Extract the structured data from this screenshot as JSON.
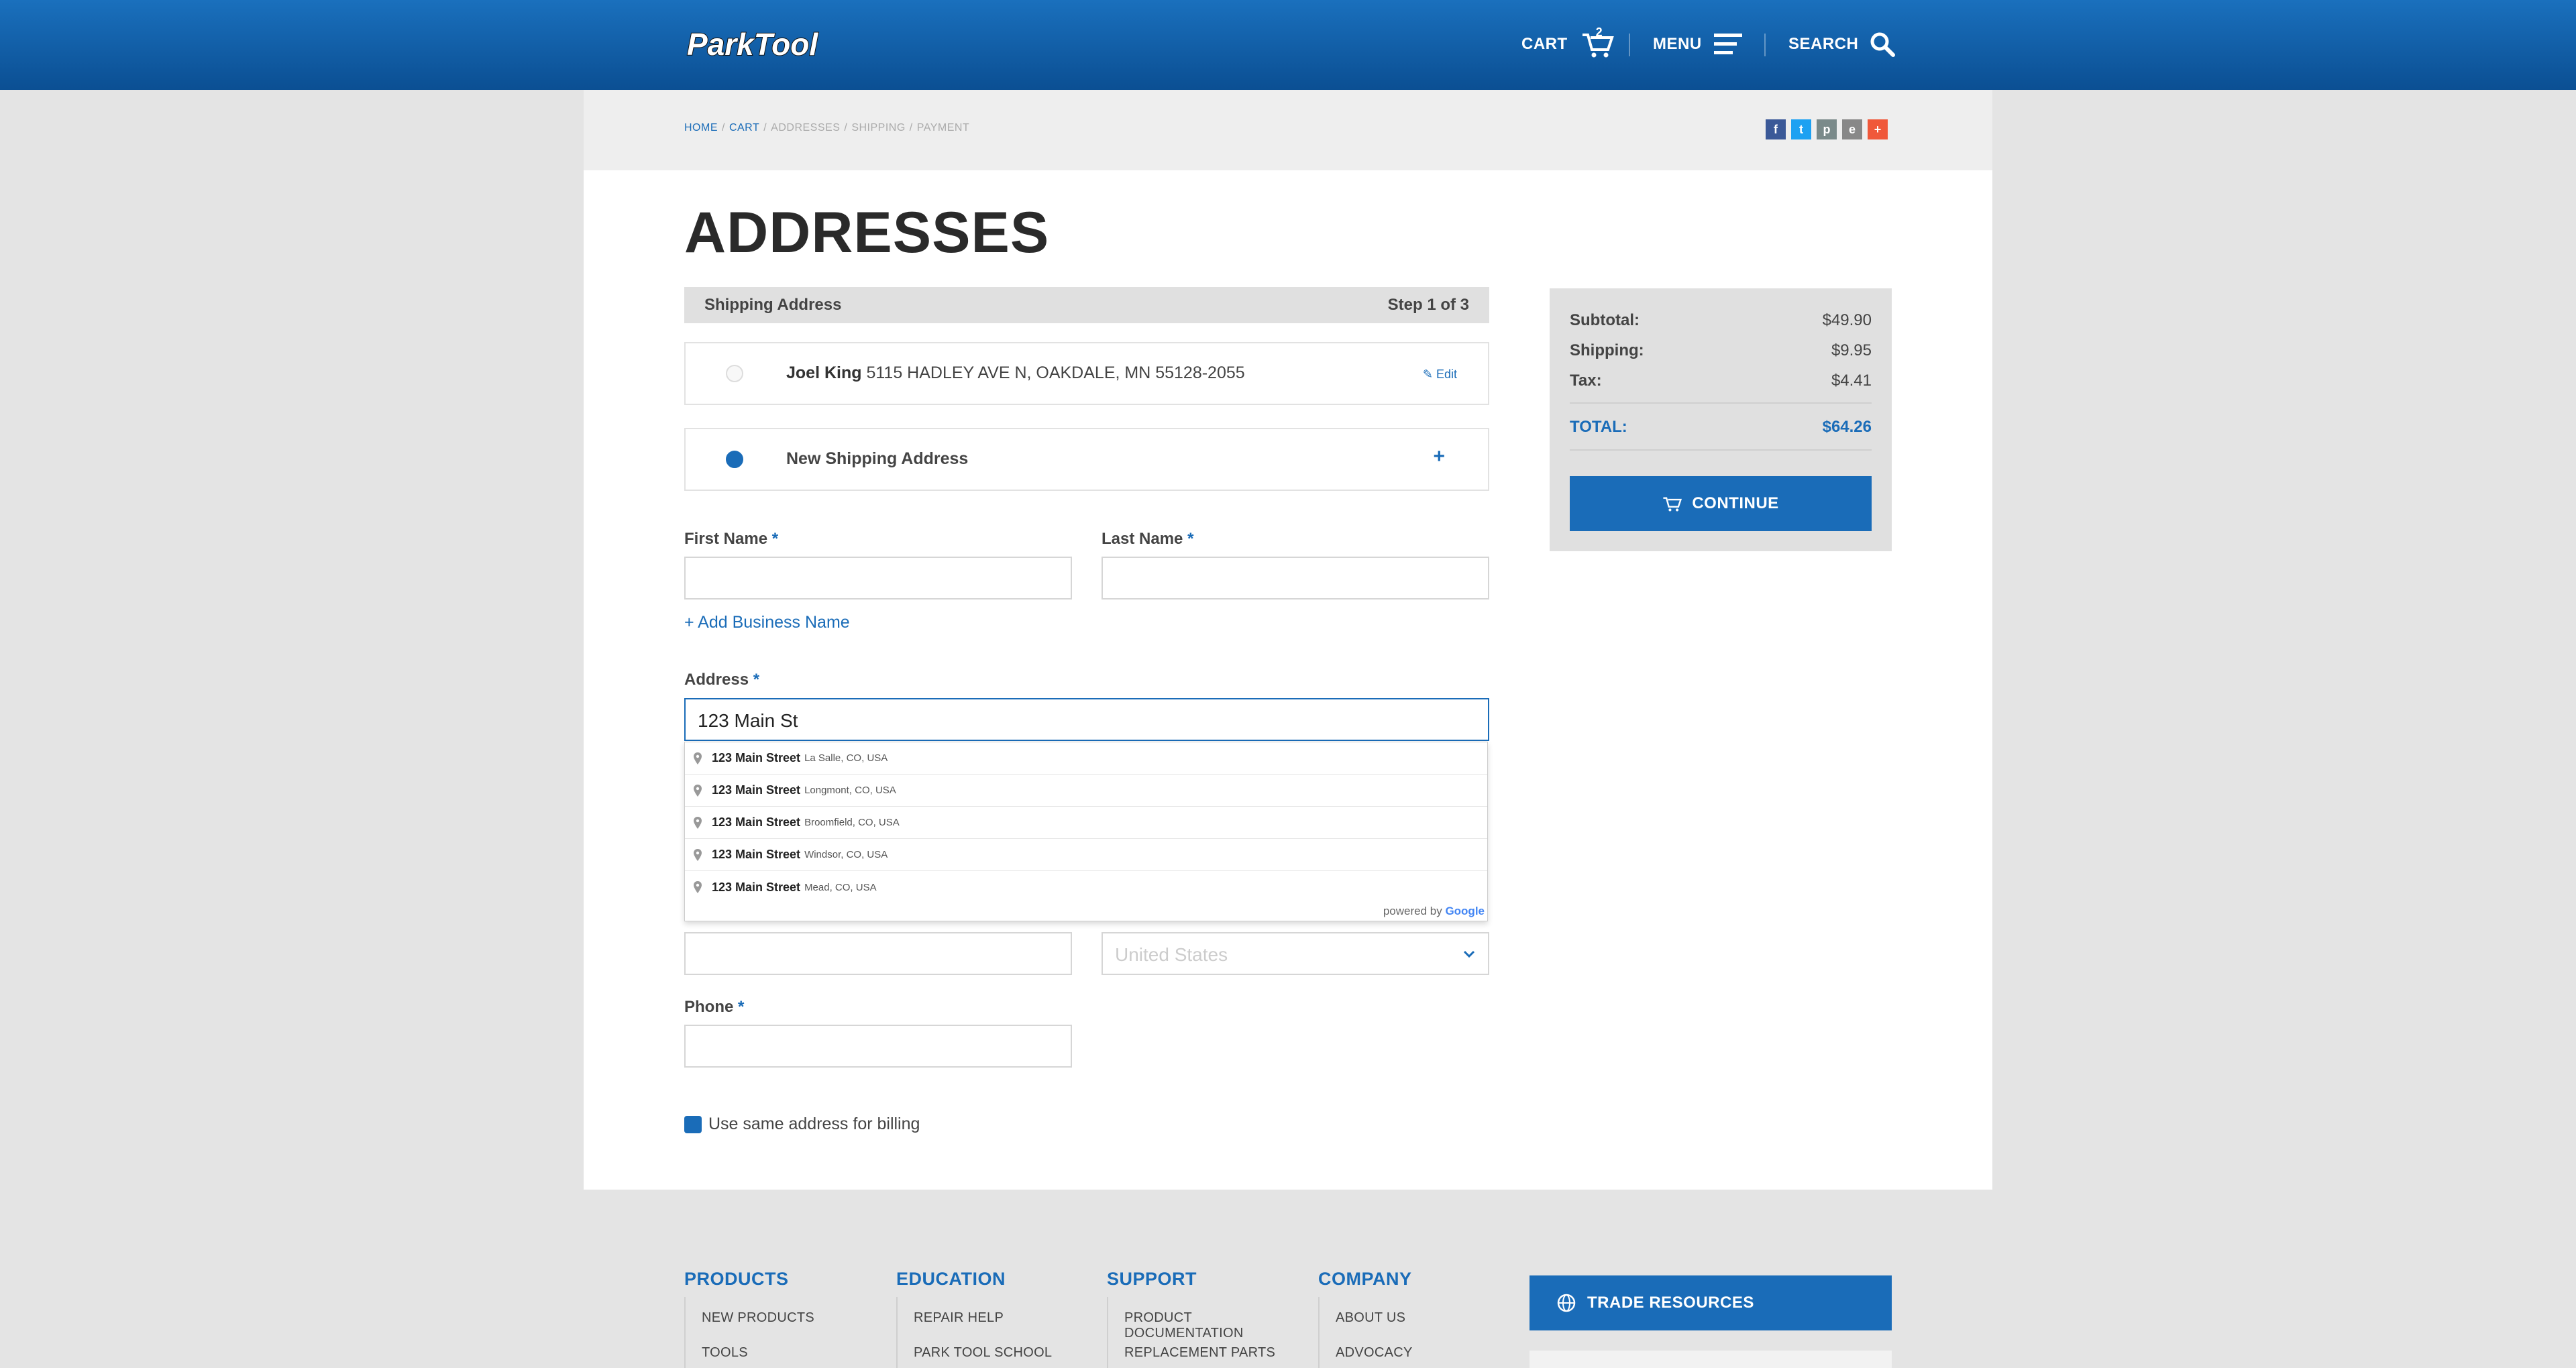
{
  "header": {
    "logo_text": "ParkTool",
    "cart_label": "CART",
    "cart_count": "2",
    "menu_label": "MENU",
    "search_label": "SEARCH"
  },
  "breadcrumb": {
    "home": "HOME",
    "cart": "CART",
    "addresses": "ADDRESSES",
    "shipping": "SHIPPING",
    "payment": "PAYMENT",
    "sep": "/"
  },
  "share": {
    "facebook": "f",
    "twitter": "t",
    "print": "p",
    "email": "e",
    "more": "+"
  },
  "page": {
    "title": "ADDRESSES"
  },
  "step": {
    "label": "Shipping Address",
    "progress": "Step 1 of 3"
  },
  "saved_address": {
    "name": "Joel King",
    "address": "5115 HADLEY AVE N, OAKDALE, MN 55128-2055",
    "edit": "Edit"
  },
  "new_address": {
    "label": "New Shipping Address",
    "expand": "+"
  },
  "form": {
    "first_name": "First Name",
    "last_name": "Last Name",
    "required_mark": "*",
    "add_business": "+ Add Business Name",
    "address_label": "Address",
    "address_value": "123 Main St",
    "country_value": "United States",
    "phone_label": "Phone",
    "billing_same": "Use same address for billing"
  },
  "autocomplete": {
    "items": [
      {
        "main": "123 Main Street",
        "secondary": "La Salle, CO, USA"
      },
      {
        "main": "123 Main Street",
        "secondary": "Longmont, CO, USA"
      },
      {
        "main": "123 Main Street",
        "secondary": "Broomfield, CO, USA"
      },
      {
        "main": "123 Main Street",
        "secondary": "Windsor, CO, USA"
      },
      {
        "main": "123 Main Street",
        "secondary": "Mead, CO, USA"
      }
    ],
    "powered_by": "powered by",
    "google": "Google"
  },
  "summary": {
    "subtotal_label": "Subtotal:",
    "subtotal": "$49.90",
    "shipping_label": "Shipping:",
    "shipping": "$9.95",
    "tax_label": "Tax:",
    "tax": "$4.41",
    "total_label": "TOTAL:",
    "total": "$64.26",
    "continue": "CONTINUE"
  },
  "footer": {
    "products": {
      "title": "PRODUCTS",
      "links": [
        "NEW PRODUCTS",
        "TOOLS"
      ]
    },
    "education": {
      "title": "EDUCATION",
      "links": [
        "REPAIR HELP",
        "PARK TOOL SCHOOL"
      ]
    },
    "support": {
      "title": "SUPPORT",
      "links": [
        "PRODUCT DOCUMENTATION",
        "REPLACEMENT PARTS"
      ]
    },
    "company": {
      "title": "COMPANY",
      "links": [
        "ABOUT US",
        "ADVOCACY"
      ]
    },
    "trade": "TRADE RESOURCES"
  },
  "colors": {
    "brand": "#1a6cb8",
    "header": "#0b4f93"
  }
}
